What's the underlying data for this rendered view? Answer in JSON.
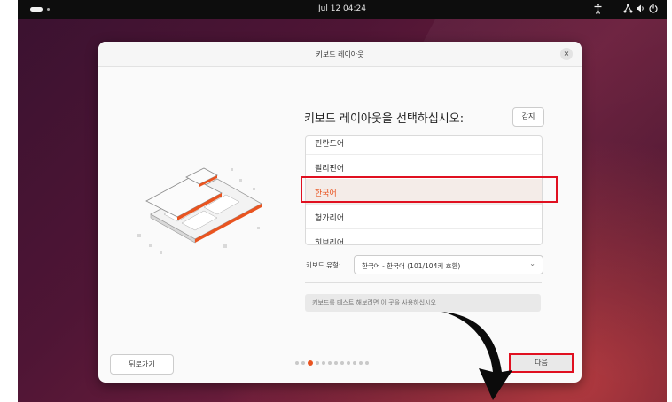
{
  "topbar": {
    "clock": "Jul 12  04:24"
  },
  "dialog": {
    "title": "키보드 레이아웃",
    "close_label": "×",
    "heading": "키보드 레이아웃을 선택하십시오:",
    "detect_label": "감지",
    "layouts": [
      "핀란드어",
      "필리핀어",
      "한국어",
      "헝가리어",
      "히브리어"
    ],
    "selected_layout": "한국어",
    "type_label": "키보드 유형:",
    "type_value": "한국어 - 한국어 (101/104키 호환)",
    "test_placeholder": "키보드를 테스트 해보려면 이 곳을 사용하십시오",
    "back_label": "뒤로가기",
    "next_label": "다음",
    "pager": {
      "current": 3,
      "total": 12
    }
  },
  "colors": {
    "accent": "#e95420",
    "annotation": "#e01020"
  },
  "icons": [
    "chevron-down-icon",
    "accessibility-icon",
    "network-icon",
    "volume-icon",
    "power-icon"
  ]
}
